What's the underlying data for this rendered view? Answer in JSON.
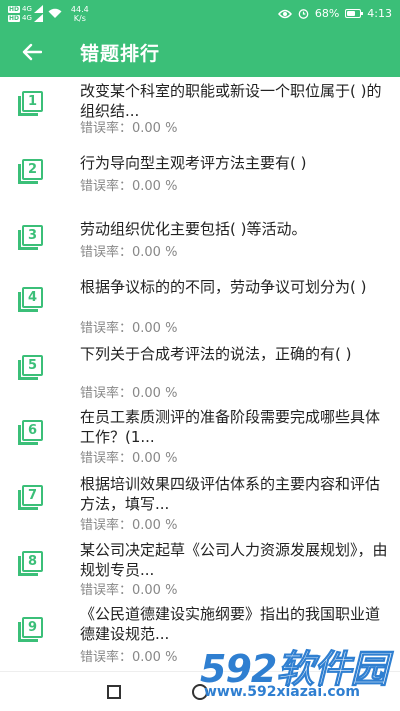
{
  "status_bar": {
    "sim1": "HD",
    "sim1_net": "4G",
    "sim2": "HD",
    "sim2_net": "4G",
    "speed_value": "44.4",
    "speed_unit": "K/s",
    "battery_percent": "68%",
    "battery_level": 0.68,
    "time": "4:13"
  },
  "app_bar": {
    "back_icon": "arrow-left-icon",
    "title": "错题排行"
  },
  "list": {
    "items": [
      {
        "rank": "1",
        "question": "改变某个科室的职能或新设一个职位属于( )的组织结...",
        "error_rate": "错误率：0.00 %"
      },
      {
        "rank": "2",
        "question": "行为导向型主观考评方法主要有(   )",
        "error_rate": "错误率：0.00 %"
      },
      {
        "rank": "3",
        "question": "劳动组织优化主要包括(   )等活动。",
        "error_rate": "错误率：0.00 %"
      },
      {
        "rank": "4",
        "question": "根据争议标的的不同，劳动争议可划分为(   )",
        "error_rate": "错误率：0.00 %"
      },
      {
        "rank": "5",
        "question": "下列关于合成考评法的说法，正确的有(   )",
        "error_rate": "错误率：0.00 %"
      },
      {
        "rank": "6",
        "question": "在员工素质测评的准备阶段需要完成哪些具体工作？(1...",
        "error_rate": "错误率：0.00 %"
      },
      {
        "rank": "7",
        "question": "根据培训效果四级评估体系的主要内容和评估方法，填写...",
        "error_rate": "错误率：0.00 %"
      },
      {
        "rank": "8",
        "question": "某公司决定起草《公司人力资源发展规划》，由规划专员...",
        "error_rate": "错误率：0.00 %"
      },
      {
        "rank": "9",
        "question": "《公民道德建设实施纲要》指出的我国职业道德建设规范...",
        "error_rate": "错误率：0.00 %"
      }
    ]
  },
  "watermark": {
    "logo": "592软件园",
    "url": "www.592xiazai.com"
  },
  "colors": {
    "accent": "#3bbf78",
    "watermark": "#2f7fd1"
  }
}
